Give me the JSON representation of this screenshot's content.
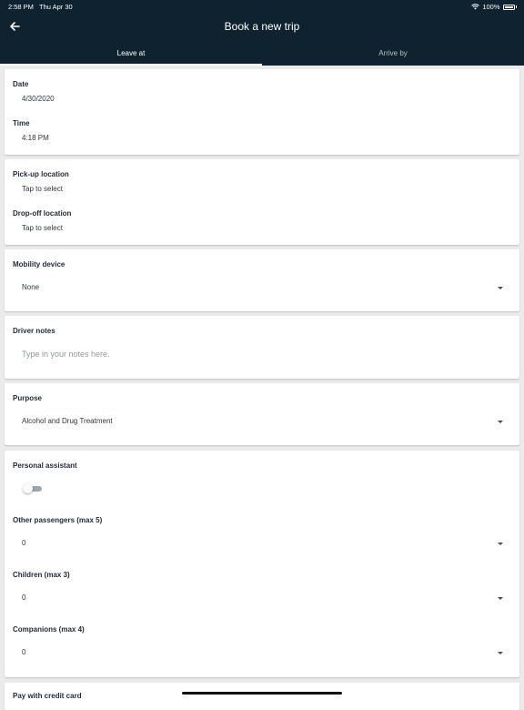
{
  "status_bar": {
    "time": "2:58 PM",
    "date": "Thu Apr 30",
    "battery": "100%"
  },
  "header": {
    "title": "Book a new trip"
  },
  "tabs": [
    {
      "label": "Leave at",
      "selected": true
    },
    {
      "label": "Arrive by",
      "selected": false
    }
  ],
  "when": {
    "date_label": "Date",
    "date_value": "4/30/2020",
    "time_label": "Time",
    "time_value": "4:18 PM"
  },
  "locations": {
    "pickup_label": "Pick-up location",
    "pickup_value": "Tap to select",
    "dropoff_label": "Drop-off location",
    "dropoff_value": "Tap to select"
  },
  "mobility": {
    "label": "Mobility device",
    "value": "None"
  },
  "notes": {
    "label": "Driver notes",
    "placeholder": "Type in your notes here."
  },
  "purpose": {
    "label": "Purpose",
    "value": "Alcohol and Drug Treatment"
  },
  "passengers": {
    "assistant_label": "Personal assistant",
    "assistant_on": false,
    "others_label": "Other passengers (max 5)",
    "others_value": "0",
    "children_label": "Children (max 3)",
    "children_value": "0",
    "companions_label": "Companions (max 4)",
    "companions_value": "0"
  },
  "payment": {
    "label": "Pay with credit card"
  },
  "colors": {
    "header_bg": "#0e2230",
    "page_bg": "#ebebeb",
    "card_bg": "#ffffff"
  }
}
